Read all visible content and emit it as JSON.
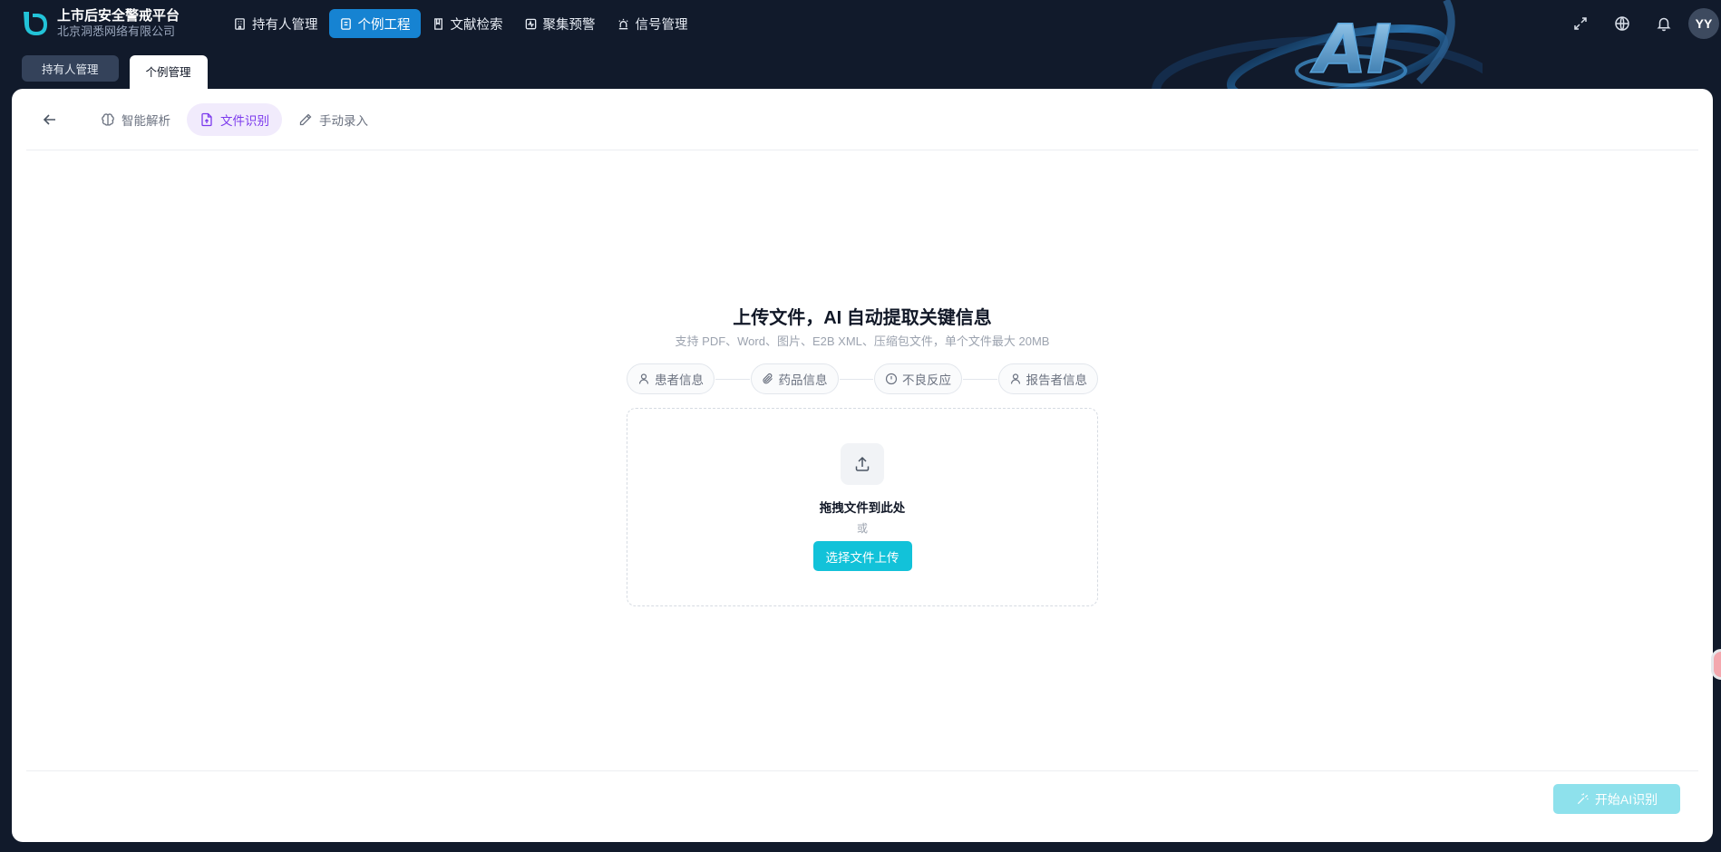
{
  "header": {
    "brand_title": "上市后安全警戒平台",
    "brand_subtitle": "北京洞悉网络有限公司",
    "nav": [
      {
        "label": "持有人管理",
        "icon": "building-icon",
        "active": false
      },
      {
        "label": "个例工程",
        "icon": "document-icon",
        "active": true
      },
      {
        "label": "文献检索",
        "icon": "book-icon",
        "active": false
      },
      {
        "label": "聚集预警",
        "icon": "activity-icon",
        "active": false
      },
      {
        "label": "信号管理",
        "icon": "siren-icon",
        "active": false
      }
    ],
    "right_icons": [
      "fullscreen-icon",
      "globe-icon",
      "bell-icon"
    ],
    "avatar_initials": "YY",
    "accent_color": "#1683d2"
  },
  "page_tabs": [
    {
      "label": "持有人管理",
      "active": false
    },
    {
      "label": "个例管理",
      "active": true
    }
  ],
  "mode_tabs": [
    {
      "label": "智能解析",
      "icon": "brain-icon",
      "active": false
    },
    {
      "label": "文件识别",
      "icon": "file-upload-icon",
      "active": true
    },
    {
      "label": "手动录入",
      "icon": "pencil-icon",
      "active": false
    }
  ],
  "upload": {
    "title": "上传文件，AI 自动提取关键信息",
    "subtitle": "支持 PDF、Word、图片、E2B XML、压缩包文件，单个文件最大 20MB",
    "steps": [
      {
        "label": "患者信息",
        "icon": "user-icon"
      },
      {
        "label": "药品信息",
        "icon": "paperclip-icon"
      },
      {
        "label": "不良反应",
        "icon": "alert-circle-icon"
      },
      {
        "label": "报告者信息",
        "icon": "user-icon"
      }
    ],
    "drop_title": "拖拽文件到此处",
    "drop_or": "或",
    "select_button": "选择文件上传",
    "button_color": "#12c2d9"
  },
  "footer": {
    "start_button": "开始AI识别",
    "start_enabled": false
  }
}
